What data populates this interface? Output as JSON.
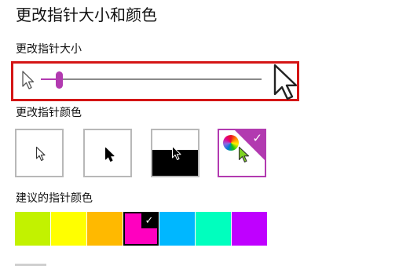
{
  "title": "更改指针大小和颜色",
  "size_section": {
    "label": "更改指针大小",
    "slider_value": 1,
    "slider_max": 15
  },
  "color_section": {
    "label": "更改指针颜色",
    "options": [
      {
        "id": "white",
        "icon": "white-pointer-icon"
      },
      {
        "id": "black",
        "icon": "black-pointer-icon"
      },
      {
        "id": "inverted",
        "icon": "inverted-pointer-icon"
      },
      {
        "id": "custom",
        "icon": "color-wheel-icon",
        "selected": true
      }
    ]
  },
  "suggest_section": {
    "label": "建议的指针颜色",
    "swatches": [
      {
        "color": "#c2f200"
      },
      {
        "color": "#ffff00"
      },
      {
        "color": "#ffb900"
      },
      {
        "color": "#ff00bf",
        "selected": true
      },
      {
        "color": "#00b7ff"
      },
      {
        "color": "#00ffbe"
      },
      {
        "color": "#bf00ff"
      }
    ]
  },
  "colors": {
    "accent": "#b23ab0",
    "highlight": "#d41515"
  }
}
